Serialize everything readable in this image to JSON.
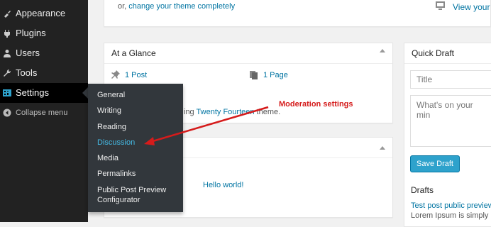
{
  "sidebar": {
    "items": [
      {
        "label": "Appearance",
        "icon": "paintbrush-icon"
      },
      {
        "label": "Plugins",
        "icon": "plug-icon"
      },
      {
        "label": "Users",
        "icon": "user-icon"
      },
      {
        "label": "Tools",
        "icon": "wrench-icon"
      },
      {
        "label": "Settings",
        "icon": "settings-icon",
        "current": true
      }
    ],
    "collapse_label": "Collapse menu",
    "accent": "#2ea2cc"
  },
  "settings_menu": {
    "items": [
      {
        "label": "General"
      },
      {
        "label": "Writing"
      },
      {
        "label": "Reading"
      },
      {
        "label": "Discussion",
        "active": true
      },
      {
        "label": "Media"
      },
      {
        "label": "Permalinks"
      },
      {
        "label": "Public Post Preview Configurator"
      }
    ]
  },
  "welcome": {
    "change_theme_prefix": "or, ",
    "change_theme_link": "change your theme completely",
    "view_site_label": "View your"
  },
  "at_a_glance": {
    "title": "At a Glance",
    "posts": "1 Post",
    "pages": "1 Page",
    "theme_prefix": "ing ",
    "theme_name": "Twenty Fourteen",
    "theme_suffix": " theme."
  },
  "activity": {
    "post_link": "Hello world!"
  },
  "quick_draft": {
    "title": "Quick Draft",
    "title_placeholder": "Title",
    "content_placeholder": "What's on your min",
    "save_label": "Save Draft",
    "drafts_heading": "Drafts",
    "draft_link": "Test post public preview",
    "draft_excerpt": "Lorem Ipsum is simply"
  },
  "annotation": {
    "text": "Moderation settings",
    "color": "#d51b1b"
  }
}
